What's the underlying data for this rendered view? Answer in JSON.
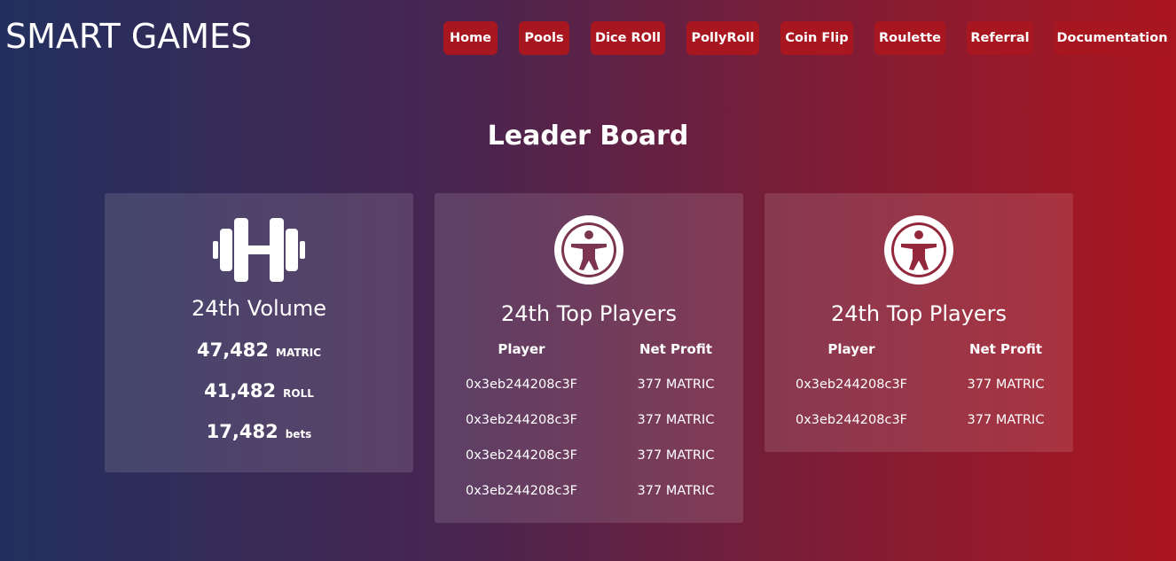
{
  "header": {
    "brand": "SMART GAMES",
    "nav": [
      {
        "label": "Home"
      },
      {
        "label": "Pools"
      },
      {
        "label": "Dice ROll"
      },
      {
        "label": "PollyRoll"
      },
      {
        "label": "Coin Flip"
      },
      {
        "label": "Roulette"
      },
      {
        "label": "Referral"
      },
      {
        "label": "Documentation"
      }
    ]
  },
  "main": {
    "title": "Leader Board",
    "volume_card": {
      "icon": "dumbbell-icon",
      "heading": "24th Volume",
      "stats": [
        {
          "value": "47,482",
          "unit": "MATRIC"
        },
        {
          "value": "41,482",
          "unit": "ROLL"
        },
        {
          "value": "17,482",
          "unit": "bets"
        }
      ]
    },
    "players_card_1": {
      "icon": "accessibility-icon",
      "heading": "24th Top Players",
      "columns": [
        "Player",
        "Net Profit"
      ],
      "rows": [
        {
          "player": "0x3eb244208c3F",
          "profit": "377 MATRIC"
        },
        {
          "player": "0x3eb244208c3F",
          "profit": "377 MATRIC"
        },
        {
          "player": "0x3eb244208c3F",
          "profit": "377 MATRIC"
        },
        {
          "player": "0x3eb244208c3F",
          "profit": "377 MATRIC"
        }
      ]
    },
    "players_card_2": {
      "icon": "accessibility-icon",
      "heading": "24th Top Players",
      "columns": [
        "Player",
        "Net Profit"
      ],
      "rows": [
        {
          "player": "0x3eb244208c3F",
          "profit": "377 MATRIC"
        },
        {
          "player": "0x3eb244208c3F",
          "profit": "377 MATRIC"
        }
      ]
    }
  },
  "colors": {
    "nav_button": "#a8161f",
    "gradient_left": "#22305f",
    "gradient_right": "#ab161f"
  }
}
